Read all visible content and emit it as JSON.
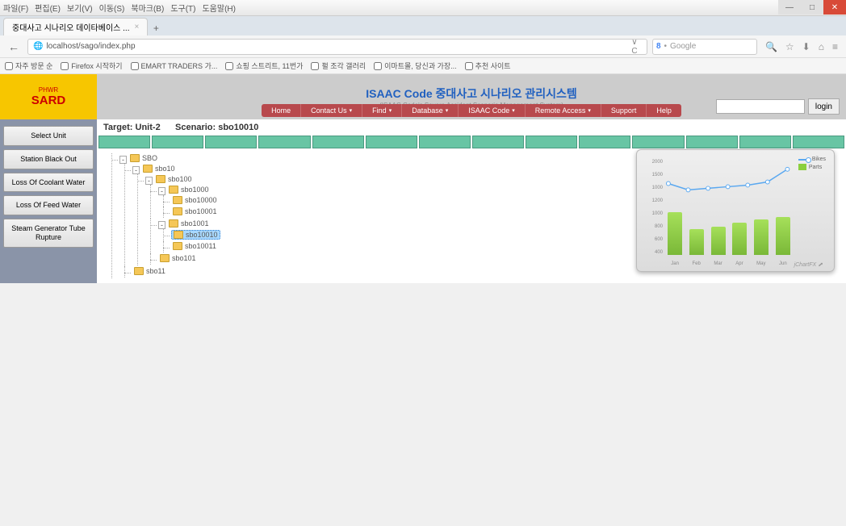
{
  "window_menu": [
    "파일(F)",
    "편집(E)",
    "보기(V)",
    "이동(S)",
    "북마크(B)",
    "도구(T)",
    "도움말(H)"
  ],
  "tab_title": "중대사고 시나리오 데이타베이스 ...",
  "url": "localhost/sago/index.php",
  "search_placeholder": "Google",
  "bookmarks": [
    "자주 방문 순",
    "Firefox 시작하기",
    "EMART TRADERS 가...",
    "쇼핑 스트리트, 11번가",
    "펄 조각 갤러리",
    "이마트몰, 당신과 가장...",
    "추천 사이트"
  ],
  "logo": {
    "top": "PHWR",
    "main": "SARD"
  },
  "title_main": "ISAAC Code 중대사고 시나리오 관리시스템",
  "title_sub": "(ISAAC Code's Severe Accident Scenario Management System)",
  "nav": [
    "Home",
    "Contact Us",
    "Find",
    "Database",
    "ISAAC Code",
    "Remote Access",
    "Support",
    "Help"
  ],
  "nav_dropdown": [
    false,
    true,
    true,
    true,
    true,
    true,
    false,
    false
  ],
  "login_label": "login",
  "target_label": "Target: Unit-2",
  "scenario_label": "Scenario: sbo10010",
  "side_buttons": [
    "Select Unit",
    "Station Black Out",
    "Loss Of Coolant Water",
    "Loss Of Feed Water",
    "Steam Generator Tube Rupture"
  ],
  "tree": {
    "root": "SBO",
    "children": [
      {
        "name": "sbo10",
        "children": [
          {
            "name": "sbo100",
            "children": [
              {
                "name": "sbo1000",
                "children": [
                  {
                    "name": "sbo10000"
                  },
                  {
                    "name": "sbo10001"
                  }
                ]
              },
              {
                "name": "sbo1001",
                "children": [
                  {
                    "name": "sbo10010",
                    "selected": true
                  },
                  {
                    "name": "sbo10011"
                  }
                ]
              },
              {
                "name": "sbo101"
              }
            ]
          }
        ]
      },
      {
        "name": "sbo11"
      }
    ]
  },
  "chart_data": {
    "type": "bar+line",
    "categories": [
      "Jan",
      "Feb",
      "Mar",
      "Apr",
      "May",
      "Jun"
    ],
    "series": [
      {
        "name": "Bikes",
        "type": "line",
        "values": [
          1050,
          980,
          1000,
          1020,
          1040,
          1080,
          1260
        ]
      },
      {
        "name": "Parts",
        "type": "bar",
        "values": [
          1280,
          780,
          860,
          980,
          1060,
          1150
        ]
      }
    ],
    "y_ticks_upper": [
      "2000",
      "1500",
      "1000"
    ],
    "y_ticks_lower": [
      "1200",
      "1000",
      "800",
      "600",
      "400"
    ],
    "brand": "jChartFX"
  }
}
